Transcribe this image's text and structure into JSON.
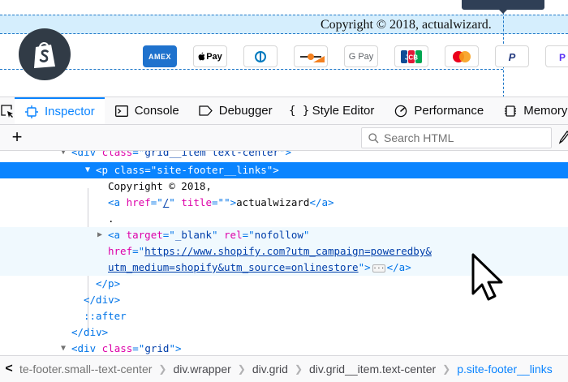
{
  "preview": {
    "copyright": "Copyright © 2018, actualwizard.",
    "payments": [
      {
        "name": "amex",
        "label": "AMEX"
      },
      {
        "name": "apple-pay",
        "label": "Pay"
      },
      {
        "name": "diners-club",
        "label": ""
      },
      {
        "name": "discover",
        "label": ""
      },
      {
        "name": "google-pay",
        "label": "G Pay"
      },
      {
        "name": "jcb",
        "label": "JCB"
      },
      {
        "name": "mastercard",
        "label": ""
      },
      {
        "name": "paypal",
        "label": "P"
      },
      {
        "name": "shopify-pay",
        "label": "P"
      }
    ],
    "colors": {
      "highlight": "#87cefa",
      "guide": "#1f78c8",
      "shopify_logo_bg": "#313b46",
      "shopify_green": "#95bf47"
    }
  },
  "toolbar": {
    "tabs": [
      {
        "label": "Inspector",
        "icon": "inspector-icon",
        "selected": true
      },
      {
        "label": "Console",
        "icon": "console-icon"
      },
      {
        "label": "Debugger",
        "icon": "debugger-icon"
      },
      {
        "label": "Style Editor",
        "icon": "style-editor-icon",
        "glyph": "{ }"
      },
      {
        "label": "Performance",
        "icon": "performance-icon"
      },
      {
        "label": "Memory",
        "icon": "memory-icon"
      }
    ],
    "accent": "#0a84ff"
  },
  "search": {
    "placeholder": "Search HTML"
  },
  "tree": {
    "l1": {
      "open": "<",
      "tag": "div",
      "attr": "class",
      "eq": "=\"",
      "val": "grid__item text-center",
      "close": "\">"
    },
    "l2": {
      "open": "<",
      "tag": "p",
      "attr": "class",
      "eq": "=\"",
      "val": "site-footer__links",
      "close": "\">"
    },
    "l3": {
      "text": "Copyright © 2018,"
    },
    "l4": {
      "open": "<",
      "tag": "a",
      "attr1": "href",
      "eq1": "=\"",
      "val1": "/",
      "q1": "\"",
      "attr2": "title",
      "eq2": "=\"",
      "q2": "\">",
      "text": "actualwizard",
      "end": "</a>"
    },
    "l5": {
      "text": "."
    },
    "l6": {
      "open": "<",
      "tag": "a",
      "attr1": "target",
      "eq1": "=\"",
      "val1": "_blank",
      "q1": "\"",
      "attr2": "rel",
      "eq2": "=\"",
      "val2": "nofollow",
      "q2": "\""
    },
    "l7": {
      "attr": "href",
      "eq": "=\"",
      "val": "https://www.shopify.com?utm_campaign=poweredby&"
    },
    "l8": {
      "val": "utm_medium=shopify&utm_source=onlinestore",
      "q": "\">",
      "end": "</a>"
    },
    "l9": {
      "text": "</p>"
    },
    "l10": {
      "text": "</div>"
    },
    "l11": {
      "text": "::after"
    },
    "l12": {
      "text": "</div>"
    },
    "l13": {
      "open": "<",
      "tag": "div",
      "attr": "class",
      "eq": "=\"",
      "val": "grid",
      "close": "\">"
    }
  },
  "breadcrumbs": [
    {
      "label": "te-footer.small--text-center",
      "state": "truncated"
    },
    {
      "label": "div.wrapper"
    },
    {
      "label": "div.grid"
    },
    {
      "label": "div.grid__item.text-center"
    },
    {
      "label": "p.site-footer__links",
      "state": "active"
    }
  ]
}
